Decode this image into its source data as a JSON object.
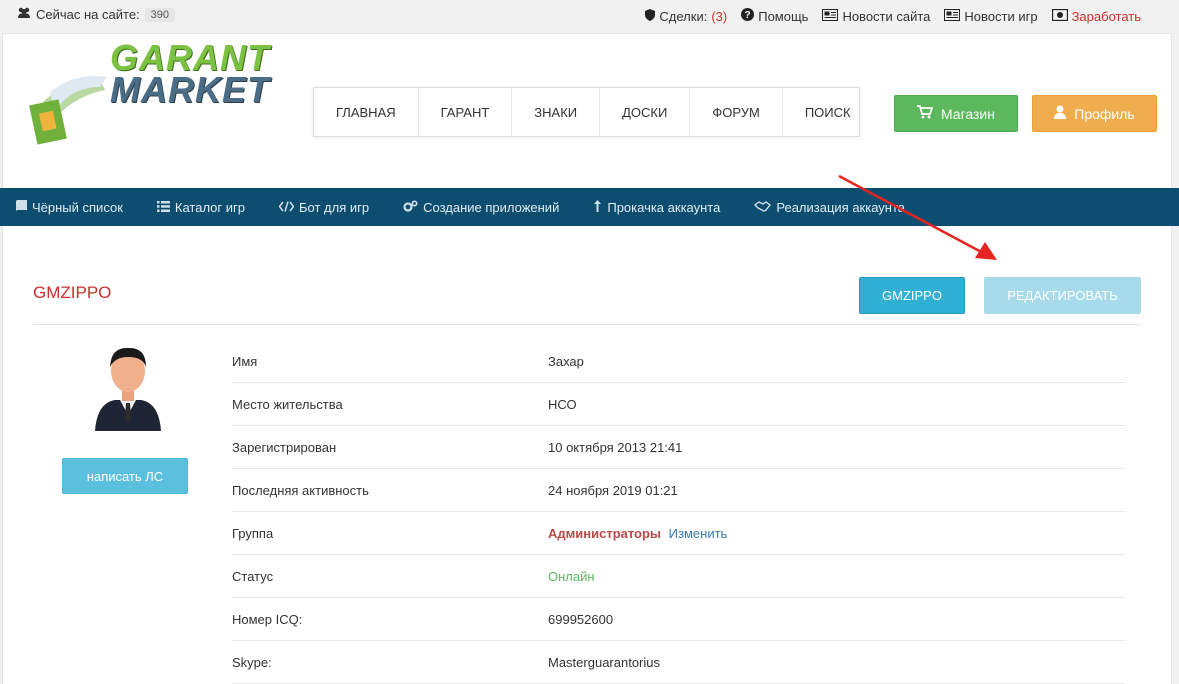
{
  "topbar": {
    "online_label": "Сейчас на сайте:",
    "online_count": "390",
    "links": {
      "deals_label": "Сделки:",
      "deals_count": "(3)",
      "help": "Помощь",
      "site_news": "Новости сайта",
      "game_news": "Новости игр",
      "earn": "Заработать"
    }
  },
  "logo": {
    "line1": "GARANT",
    "line2": "MARKET"
  },
  "mainnav": [
    "ГЛАВНАЯ",
    "ГАРАНТ",
    "ЗНАКИ",
    "ДОСКИ",
    "ФОРУМ",
    "ПОИСК"
  ],
  "actions": {
    "shop": "Магазин",
    "profile": "Профиль"
  },
  "subnav": [
    "Чёрный список",
    "Каталог игр",
    "Бот для игр",
    "Создание приложений",
    "Прокачка аккаунта",
    "Реализация аккаунта"
  ],
  "profile": {
    "title": "GMZIPPO",
    "user_button": "GMZIPPO",
    "edit_button": "РЕДАКТИРОВАТЬ",
    "pm_button": "написать ЛС",
    "rows": {
      "name": {
        "label": "Имя",
        "value": "Захар"
      },
      "location": {
        "label": "Место жительства",
        "value": "НСО"
      },
      "registered": {
        "label": "Зарегистрирован",
        "value": "10 октября 2013 21:41"
      },
      "last_active": {
        "label": "Последняя активность",
        "value": "24 ноября 2019 01:21"
      },
      "group": {
        "label": "Группа",
        "value": "Администраторы",
        "change": "Изменить"
      },
      "status": {
        "label": "Статус",
        "value": "Онлайн"
      },
      "icq": {
        "label": "Номер ICQ:",
        "value": "699952600"
      },
      "skype": {
        "label": "Skype:",
        "value": "Masterguarantorius"
      }
    }
  },
  "colors": {
    "brand_red": "#c9302c",
    "subnav_bg": "#0d4d70",
    "green": "#5cb85c",
    "orange": "#f0ad4e",
    "info": "#5bc0de"
  }
}
